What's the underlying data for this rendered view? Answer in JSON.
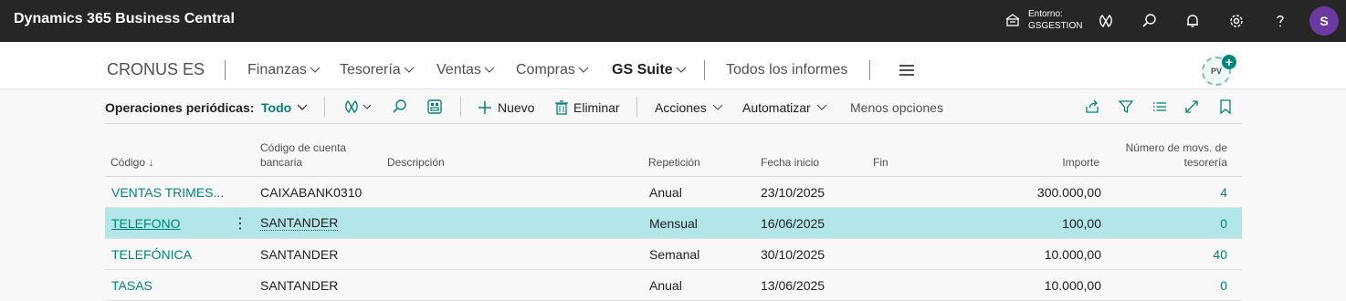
{
  "app": {
    "title": "Dynamics 365 Business Central"
  },
  "environment": {
    "label": "Entorno:",
    "name": "GSGESTION"
  },
  "user": {
    "initial": "S"
  },
  "nav": {
    "company": "CRONUS ES",
    "items": [
      "Finanzas",
      "Tesorería",
      "Ventas",
      "Compras",
      "GS Suite"
    ],
    "reports": "Todos los informes",
    "badge": "PV"
  },
  "actions": {
    "title": "Operaciones periódicas:",
    "filter": "Todo",
    "new": "Nuevo",
    "delete": "Eliminar",
    "actions": "Acciones",
    "automate": "Automatizar",
    "less": "Menos opciones"
  },
  "table": {
    "headers": {
      "code": "Código ↓",
      "bank_line1": "Código de cuenta",
      "bank_line2": "bancaria",
      "description": "Descripción",
      "repetition": "Repetición",
      "start": "Fecha inicio",
      "end": "Fin",
      "amount": "Importe",
      "movs_line1": "Número de movs. de",
      "movs_line2": "tesorería"
    },
    "rows": [
      {
        "code": "VENTAS TRIMES...",
        "bank": "CAIXABANK0310",
        "description": "",
        "repetition": "Anual",
        "start": "23/10/2025",
        "end": "",
        "amount": "300.000,00",
        "movs": "4"
      },
      {
        "code": "TELEFONO",
        "bank": "SANTANDER",
        "description": "",
        "repetition": "Mensual",
        "start": "16/06/2025",
        "end": "",
        "amount": "100,00",
        "movs": "0"
      },
      {
        "code": "TELEFÓNICA",
        "bank": "SANTANDER",
        "description": "",
        "repetition": "Semanal",
        "start": "30/10/2025",
        "end": "",
        "amount": "10.000,00",
        "movs": "40"
      },
      {
        "code": "TASAS",
        "bank": "SANTANDER",
        "description": "",
        "repetition": "Anual",
        "start": "13/06/2025",
        "end": "",
        "amount": "10.000,00",
        "movs": "0"
      }
    ]
  },
  "colors": {
    "accent": "#00857a",
    "topbar": "#262626",
    "selected_row": "#b3e6e8",
    "avatar": "#6a3aa0"
  }
}
